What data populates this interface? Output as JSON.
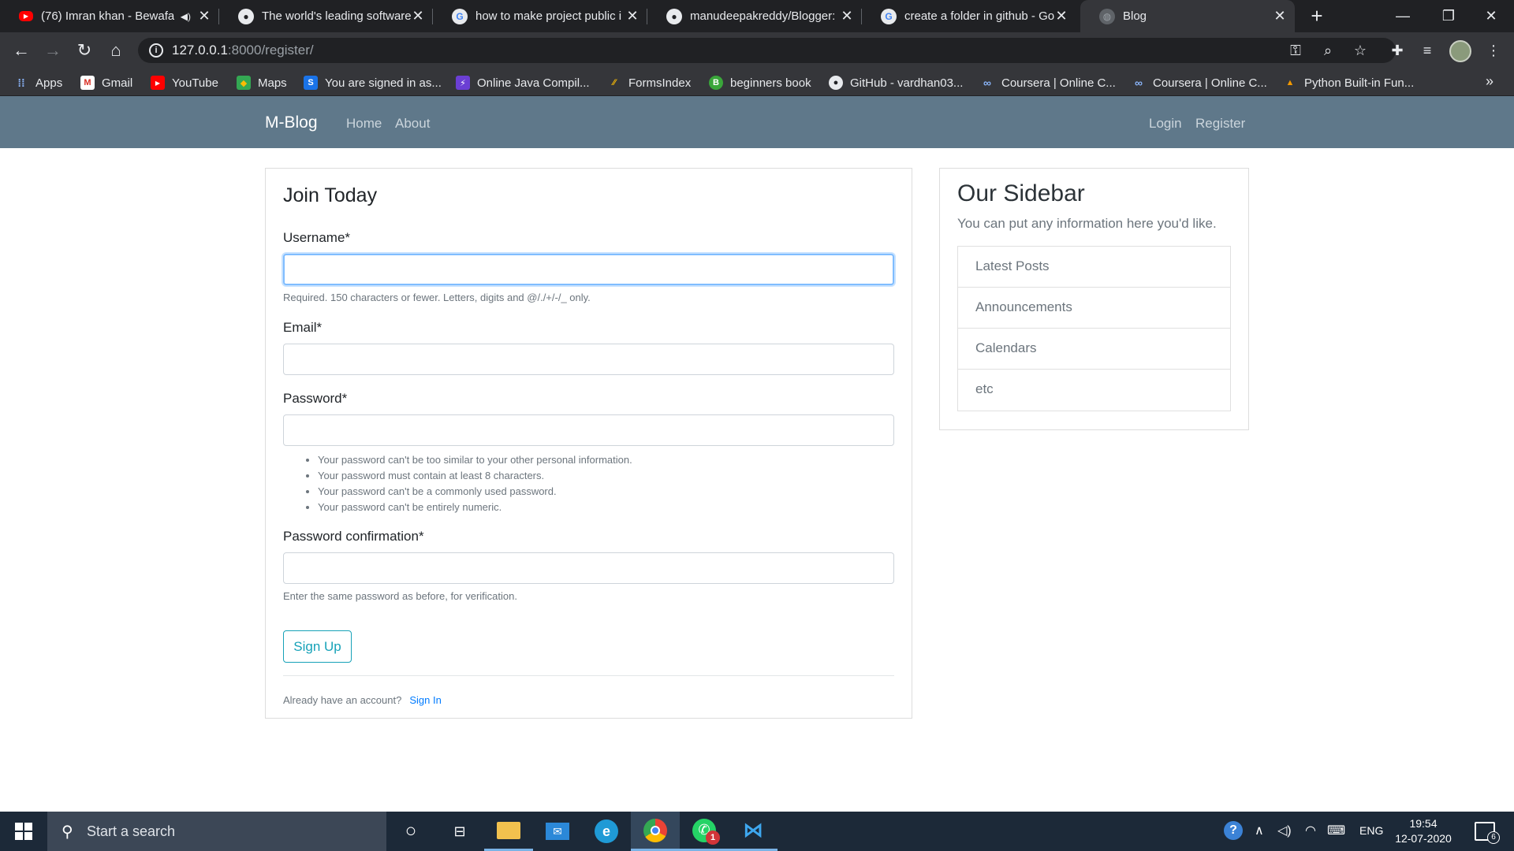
{
  "browser": {
    "tabs": [
      {
        "title": "(76) Imran khan - Bewafa",
        "icon": "youtube-icon"
      },
      {
        "title": "The world's leading software",
        "icon": "github-icon"
      },
      {
        "title": "how to make project public i",
        "icon": "google-icon"
      },
      {
        "title": "manudeepakreddy/Blogger:",
        "icon": "github-icon"
      },
      {
        "title": "create a folder in github - Go",
        "icon": "google-icon"
      },
      {
        "title": "Blog",
        "icon": "globe-icon"
      }
    ],
    "url_host": "127.0.0.1",
    "url_rest": ":8000/register/",
    "bookmarks": [
      {
        "label": "Apps",
        "icon": "apps-grid-icon"
      },
      {
        "label": "Gmail",
        "icon": "gmail-icon"
      },
      {
        "label": "YouTube",
        "icon": "youtube-icon"
      },
      {
        "label": "Maps",
        "icon": "maps-icon"
      },
      {
        "label": "You are signed in as...",
        "icon": "s-icon"
      },
      {
        "label": "Online Java Compil...",
        "icon": "bolt-icon"
      },
      {
        "label": "FormsIndex",
        "icon": "forms-icon"
      },
      {
        "label": "beginners book",
        "icon": "book-icon"
      },
      {
        "label": "GitHub - vardhan03...",
        "icon": "github-icon"
      },
      {
        "label": "Coursera | Online C...",
        "icon": "coursera-icon"
      },
      {
        "label": "Coursera | Online C...",
        "icon": "coursera-icon"
      },
      {
        "label": "Python Built-in Fun...",
        "icon": "python-icon"
      }
    ]
  },
  "site": {
    "brand": "M-Blog",
    "nav_left": [
      "Home",
      "About"
    ],
    "nav_right": [
      "Login",
      "Register"
    ]
  },
  "form": {
    "legend": "Join Today",
    "username_label": "Username*",
    "username_value": "",
    "username_help": "Required. 150 characters or fewer. Letters, digits and @/./+/-/_ only.",
    "email_label": "Email*",
    "email_value": "",
    "password_label": "Password*",
    "password_value": "",
    "password_rules": [
      "Your password can't be too similar to your other personal information.",
      "Your password must contain at least 8 characters.",
      "Your password can't be a commonly used password.",
      "Your password can't be entirely numeric."
    ],
    "password2_label": "Password confirmation*",
    "password2_value": "",
    "password2_help": "Enter the same password as before, for verification.",
    "submit_label": "Sign Up",
    "account_text": "Already have an account?",
    "signin_link": "Sign In"
  },
  "sidebar": {
    "title": "Our Sidebar",
    "subtitle": "You can put any information here you'd like.",
    "items": [
      "Latest Posts",
      "Announcements",
      "Calendars",
      "etc"
    ]
  },
  "taskbar": {
    "search_placeholder": "Start a search",
    "whatsapp_badge": "1",
    "language": "ENG",
    "time": "19:54",
    "date": "12-07-2020",
    "notification_count": "6"
  },
  "colors": {
    "navbar": "#5f788a",
    "button_outline": "#17a2b8",
    "link": "#007bff",
    "chrome_dark": "#202124",
    "taskbar": "#1c2938"
  }
}
